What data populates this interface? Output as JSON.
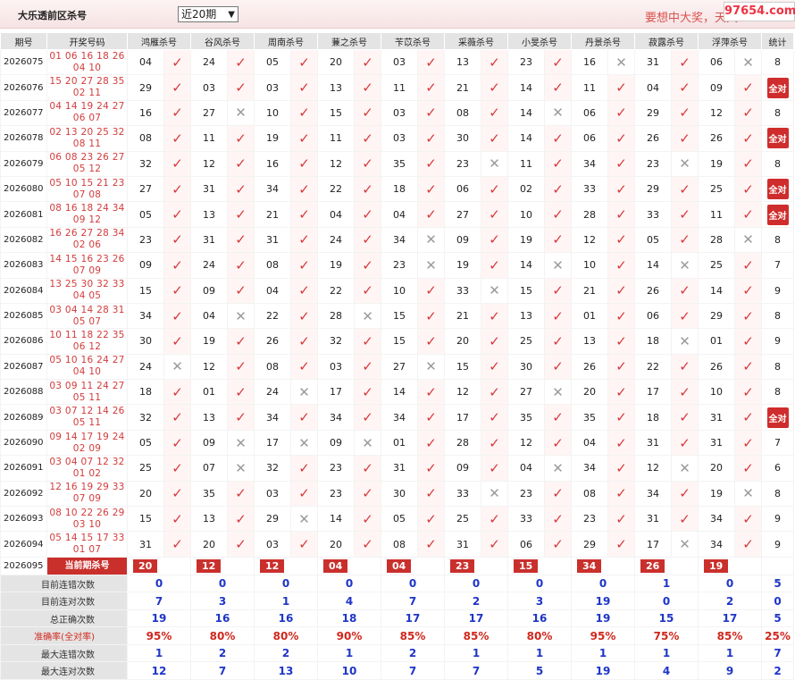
{
  "header": {
    "title": "大乐透前区杀号",
    "period_select": "近20期",
    "slogan": "要想中大奖，天天",
    "watermark": "97654.com"
  },
  "columns": [
    "期号",
    "开奖号码",
    "鸿雁杀号",
    "谷风杀号",
    "周南杀号",
    "蒹之杀号",
    "苄苡杀号",
    "采薇杀号",
    "小旻杀号",
    "丹景杀号",
    "菽露杀号",
    "浮萍杀号",
    "统计"
  ],
  "rows": [
    {
      "period": "2026075",
      "draw1": "01 06 16 18 26",
      "draw2": "04 10",
      "kills": [
        [
          "04",
          1
        ],
        [
          "24",
          1
        ],
        [
          "05",
          1
        ],
        [
          "20",
          1
        ],
        [
          "03",
          1
        ],
        [
          "13",
          1
        ],
        [
          "23",
          1
        ],
        [
          "16",
          0
        ],
        [
          "31",
          1
        ],
        [
          "06",
          0
        ]
      ],
      "stat": "8"
    },
    {
      "period": "2026076",
      "draw1": "15 20 27 28 35",
      "draw2": "02 11",
      "kills": [
        [
          "29",
          1
        ],
        [
          "03",
          1
        ],
        [
          "03",
          1
        ],
        [
          "13",
          1
        ],
        [
          "11",
          1
        ],
        [
          "21",
          1
        ],
        [
          "14",
          1
        ],
        [
          "11",
          1
        ],
        [
          "04",
          1
        ],
        [
          "09",
          1
        ]
      ],
      "stat": "全对"
    },
    {
      "period": "2026077",
      "draw1": "04 14 19 24 27",
      "draw2": "06 07",
      "kills": [
        [
          "16",
          1
        ],
        [
          "27",
          0
        ],
        [
          "10",
          1
        ],
        [
          "15",
          1
        ],
        [
          "03",
          1
        ],
        [
          "08",
          1
        ],
        [
          "14",
          0
        ],
        [
          "06",
          1
        ],
        [
          "29",
          1
        ],
        [
          "12",
          1
        ]
      ],
      "stat": "8"
    },
    {
      "period": "2026078",
      "draw1": "02 13 20 25 32",
      "draw2": "08 11",
      "kills": [
        [
          "08",
          1
        ],
        [
          "11",
          1
        ],
        [
          "19",
          1
        ],
        [
          "11",
          1
        ],
        [
          "03",
          1
        ],
        [
          "30",
          1
        ],
        [
          "14",
          1
        ],
        [
          "06",
          1
        ],
        [
          "26",
          1
        ],
        [
          "26",
          1
        ]
      ],
      "stat": "全对"
    },
    {
      "period": "2026079",
      "draw1": "06 08 23 26 27",
      "draw2": "05 12",
      "kills": [
        [
          "32",
          1
        ],
        [
          "12",
          1
        ],
        [
          "16",
          1
        ],
        [
          "12",
          1
        ],
        [
          "35",
          1
        ],
        [
          "23",
          0
        ],
        [
          "11",
          1
        ],
        [
          "34",
          1
        ],
        [
          "23",
          0
        ],
        [
          "19",
          1
        ]
      ],
      "stat": "8"
    },
    {
      "period": "2026080",
      "draw1": "05 10 15 21 23",
      "draw2": "07 08",
      "kills": [
        [
          "27",
          1
        ],
        [
          "31",
          1
        ],
        [
          "34",
          1
        ],
        [
          "22",
          1
        ],
        [
          "18",
          1
        ],
        [
          "06",
          1
        ],
        [
          "02",
          1
        ],
        [
          "33",
          1
        ],
        [
          "29",
          1
        ],
        [
          "25",
          1
        ]
      ],
      "stat": "全对"
    },
    {
      "period": "2026081",
      "draw1": "08 16 18 24 34",
      "draw2": "09 12",
      "kills": [
        [
          "05",
          1
        ],
        [
          "13",
          1
        ],
        [
          "21",
          1
        ],
        [
          "04",
          1
        ],
        [
          "04",
          1
        ],
        [
          "27",
          1
        ],
        [
          "10",
          1
        ],
        [
          "28",
          1
        ],
        [
          "33",
          1
        ],
        [
          "11",
          1
        ]
      ],
      "stat": "全对"
    },
    {
      "period": "2026082",
      "draw1": "16 26 27 28 34",
      "draw2": "02 06",
      "kills": [
        [
          "23",
          1
        ],
        [
          "31",
          1
        ],
        [
          "31",
          1
        ],
        [
          "24",
          1
        ],
        [
          "34",
          0
        ],
        [
          "09",
          1
        ],
        [
          "19",
          1
        ],
        [
          "12",
          1
        ],
        [
          "05",
          1
        ],
        [
          "28",
          0
        ]
      ],
      "stat": "8"
    },
    {
      "period": "2026083",
      "draw1": "14 15 16 23 26",
      "draw2": "07 09",
      "kills": [
        [
          "09",
          1
        ],
        [
          "24",
          1
        ],
        [
          "08",
          1
        ],
        [
          "19",
          1
        ],
        [
          "23",
          0
        ],
        [
          "19",
          1
        ],
        [
          "14",
          0
        ],
        [
          "10",
          1
        ],
        [
          "14",
          0
        ],
        [
          "25",
          1
        ]
      ],
      "stat": "7"
    },
    {
      "period": "2026084",
      "draw1": "13 25 30 32 33",
      "draw2": "04 05",
      "kills": [
        [
          "15",
          1
        ],
        [
          "09",
          1
        ],
        [
          "04",
          1
        ],
        [
          "22",
          1
        ],
        [
          "10",
          1
        ],
        [
          "33",
          0
        ],
        [
          "15",
          1
        ],
        [
          "21",
          1
        ],
        [
          "26",
          1
        ],
        [
          "14",
          1
        ]
      ],
      "stat": "9"
    },
    {
      "period": "2026085",
      "draw1": "03 04 14 28 31",
      "draw2": "05 07",
      "kills": [
        [
          "34",
          1
        ],
        [
          "04",
          0
        ],
        [
          "22",
          1
        ],
        [
          "28",
          0
        ],
        [
          "15",
          1
        ],
        [
          "21",
          1
        ],
        [
          "13",
          1
        ],
        [
          "01",
          1
        ],
        [
          "06",
          1
        ],
        [
          "29",
          1
        ]
      ],
      "stat": "8"
    },
    {
      "period": "2026086",
      "draw1": "10 11 18 22 35",
      "draw2": "06 12",
      "kills": [
        [
          "30",
          1
        ],
        [
          "19",
          1
        ],
        [
          "26",
          1
        ],
        [
          "32",
          1
        ],
        [
          "15",
          1
        ],
        [
          "20",
          1
        ],
        [
          "25",
          1
        ],
        [
          "13",
          1
        ],
        [
          "18",
          0
        ],
        [
          "01",
          1
        ]
      ],
      "stat": "9"
    },
    {
      "period": "2026087",
      "draw1": "05 10 16 24 27",
      "draw2": "04 10",
      "kills": [
        [
          "24",
          0
        ],
        [
          "12",
          1
        ],
        [
          "08",
          1
        ],
        [
          "03",
          1
        ],
        [
          "27",
          0
        ],
        [
          "15",
          1
        ],
        [
          "30",
          1
        ],
        [
          "26",
          1
        ],
        [
          "22",
          1
        ],
        [
          "26",
          1
        ]
      ],
      "stat": "8"
    },
    {
      "period": "2026088",
      "draw1": "03 09 11 24 27",
      "draw2": "05 11",
      "kills": [
        [
          "18",
          1
        ],
        [
          "01",
          1
        ],
        [
          "24",
          0
        ],
        [
          "17",
          1
        ],
        [
          "14",
          1
        ],
        [
          "12",
          1
        ],
        [
          "27",
          0
        ],
        [
          "20",
          1
        ],
        [
          "17",
          1
        ],
        [
          "10",
          1
        ]
      ],
      "stat": "8"
    },
    {
      "period": "2026089",
      "draw1": "03 07 12 14 26",
      "draw2": "05 11",
      "kills": [
        [
          "32",
          1
        ],
        [
          "13",
          1
        ],
        [
          "34",
          1
        ],
        [
          "34",
          1
        ],
        [
          "34",
          1
        ],
        [
          "17",
          1
        ],
        [
          "35",
          1
        ],
        [
          "35",
          1
        ],
        [
          "18",
          1
        ],
        [
          "31",
          1
        ]
      ],
      "stat": "全对"
    },
    {
      "period": "2026090",
      "draw1": "09 14 17 19 24",
      "draw2": "02 09",
      "kills": [
        [
          "05",
          1
        ],
        [
          "09",
          0
        ],
        [
          "17",
          0
        ],
        [
          "09",
          0
        ],
        [
          "01",
          1
        ],
        [
          "28",
          1
        ],
        [
          "12",
          1
        ],
        [
          "04",
          1
        ],
        [
          "31",
          1
        ],
        [
          "31",
          1
        ]
      ],
      "stat": "7"
    },
    {
      "period": "2026091",
      "draw1": "03 04 07 12 32",
      "draw2": "01 02",
      "kills": [
        [
          "25",
          1
        ],
        [
          "07",
          0
        ],
        [
          "32",
          1
        ],
        [
          "23",
          1
        ],
        [
          "31",
          1
        ],
        [
          "09",
          1
        ],
        [
          "04",
          0
        ],
        [
          "34",
          1
        ],
        [
          "12",
          0
        ],
        [
          "20",
          1
        ]
      ],
      "stat": "6"
    },
    {
      "period": "2026092",
      "draw1": "12 16 19 29 33",
      "draw2": "07 09",
      "kills": [
        [
          "20",
          1
        ],
        [
          "35",
          1
        ],
        [
          "03",
          1
        ],
        [
          "23",
          1
        ],
        [
          "30",
          1
        ],
        [
          "33",
          0
        ],
        [
          "23",
          1
        ],
        [
          "08",
          1
        ],
        [
          "34",
          1
        ],
        [
          "19",
          0
        ]
      ],
      "stat": "8"
    },
    {
      "period": "2026093",
      "draw1": "08 10 22 26 29",
      "draw2": "03 10",
      "kills": [
        [
          "15",
          1
        ],
        [
          "13",
          1
        ],
        [
          "29",
          0
        ],
        [
          "14",
          1
        ],
        [
          "05",
          1
        ],
        [
          "25",
          1
        ],
        [
          "33",
          1
        ],
        [
          "23",
          1
        ],
        [
          "31",
          1
        ],
        [
          "34",
          1
        ]
      ],
      "stat": "9"
    },
    {
      "period": "2026094",
      "draw1": "05 14 15 17 33",
      "draw2": "01 07",
      "kills": [
        [
          "31",
          1
        ],
        [
          "20",
          1
        ],
        [
          "03",
          1
        ],
        [
          "20",
          1
        ],
        [
          "08",
          1
        ],
        [
          "31",
          1
        ],
        [
          "06",
          1
        ],
        [
          "29",
          1
        ],
        [
          "17",
          0
        ],
        [
          "34",
          1
        ]
      ],
      "stat": "9"
    }
  ],
  "current": {
    "period": "2026095",
    "label": "当前期杀号",
    "kills": [
      "20",
      "12",
      "12",
      "04",
      "04",
      "23",
      "15",
      "34",
      "26",
      "19"
    ]
  },
  "summary": [
    {
      "label": "目前连错次数",
      "values": [
        "0",
        "0",
        "0",
        "0",
        "0",
        "0",
        "0",
        "0",
        "1",
        "0",
        "5"
      ]
    },
    {
      "label": "目前连对次数",
      "values": [
        "7",
        "3",
        "1",
        "4",
        "7",
        "2",
        "3",
        "19",
        "0",
        "2",
        "0"
      ]
    },
    {
      "label": "总正确次数",
      "values": [
        "19",
        "16",
        "16",
        "18",
        "17",
        "17",
        "16",
        "19",
        "15",
        "17",
        "5"
      ]
    },
    {
      "label": "准确率(全对率)",
      "values": [
        "95%",
        "80%",
        "80%",
        "90%",
        "85%",
        "85%",
        "80%",
        "95%",
        "75%",
        "85%",
        "25%"
      ]
    },
    {
      "label": "最大连错次数",
      "values": [
        "1",
        "2",
        "2",
        "1",
        "2",
        "1",
        "1",
        "1",
        "1",
        "1",
        "7"
      ]
    },
    {
      "label": "最大连对次数",
      "values": [
        "12",
        "7",
        "13",
        "10",
        "7",
        "7",
        "5",
        "19",
        "4",
        "9",
        "2"
      ]
    }
  ],
  "icons": {
    "check": "check-icon",
    "cross": "cross-icon"
  },
  "colors": {
    "correct": "#d9383a",
    "wrong": "#9a9a9a",
    "pill": "#c9302c",
    "count": "#1e35c8",
    "rate": "#d0281d"
  }
}
